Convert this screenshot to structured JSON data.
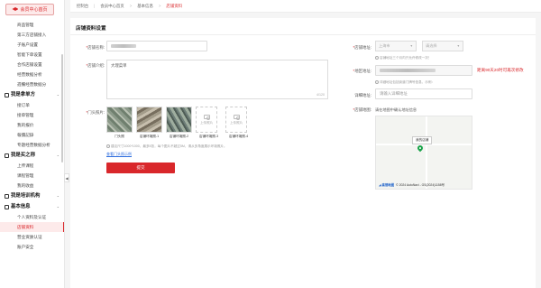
{
  "sidebar": {
    "home_button": "会员中心首页",
    "items": [
      {
        "type": "item",
        "label": "商品管理"
      },
      {
        "type": "item",
        "label": "第三方店铺接入"
      },
      {
        "type": "item",
        "label": "子账户设置"
      },
      {
        "type": "item",
        "label": "智能下单设置"
      },
      {
        "type": "item",
        "label": "合作店铺设置"
      },
      {
        "type": "item",
        "label": "经营数据分析"
      },
      {
        "type": "item",
        "label": "週備经营数据分"
      },
      {
        "type": "group",
        "label": "我是拿单方"
      },
      {
        "type": "item",
        "label": "接订单"
      },
      {
        "type": "item",
        "label": "接单管理"
      },
      {
        "type": "item",
        "label": "我的报价"
      },
      {
        "type": "item",
        "label": "報價記錄"
      },
      {
        "type": "item",
        "label": "专题经营数据分析"
      },
      {
        "type": "group",
        "label": "我是买之称"
      },
      {
        "type": "item",
        "label": "上传课程"
      },
      {
        "type": "item",
        "label": "课程管理"
      },
      {
        "type": "item",
        "label": "我的收益"
      },
      {
        "type": "group",
        "label": "我是培训机构"
      },
      {
        "type": "group",
        "label": "基本信息"
      },
      {
        "type": "item",
        "label": "个人资料及认证"
      },
      {
        "type": "item",
        "label": "店铺资料",
        "active": true
      },
      {
        "type": "item",
        "label": "营业资质认证"
      },
      {
        "type": "item",
        "label": "账户安全"
      }
    ]
  },
  "topbar": {
    "tabs": [
      "控制台",
      "会员中心首页",
      "基本信息",
      "店铺资料"
    ]
  },
  "page": {
    "title": "店铺资料设置",
    "shop_name_label": "店铺名称",
    "shop_intro_label": "店铺介绍",
    "shop_intro_value": "大理菜单",
    "shop_intro_count": "4/120",
    "door_photo_label": "门头照片",
    "thumbs": [
      "门头照",
      "店铺环境照-1",
      "店铺环境照-2",
      "店铺环境照-3",
      "店铺环境照-4"
    ],
    "upload_label": "上传照片",
    "photo_hint": "建议尺寸1000*1000，最多5张，每个图片不超过5M，请从多角度展示环境照片。",
    "example_link": "查看门头照示例",
    "submit_label": "提交",
    "shop_address_label": "店铺地址",
    "province_placeholder": "上海市",
    "district_placeholder": "请选择",
    "address_hint": "店铺地址三个月内只允许修改一次！",
    "detail_address_label": "地区地址",
    "detail_address_hint": "详细地址包括街道门牌号信息，示例：",
    "red_note": "距离90天20时可再次修改",
    "street_label": "详细地址",
    "street_placeholder": "请输入详细地址",
    "map_label": "店铺地图",
    "map_hint": "请在地图中确认地址信息",
    "map_pin_label": "我的店铺",
    "map_footer": "© 2024 AutoNavi - GS(2024)1158号"
  },
  "colors": {
    "accent": "#d9272b",
    "link": "#2f6ede"
  }
}
